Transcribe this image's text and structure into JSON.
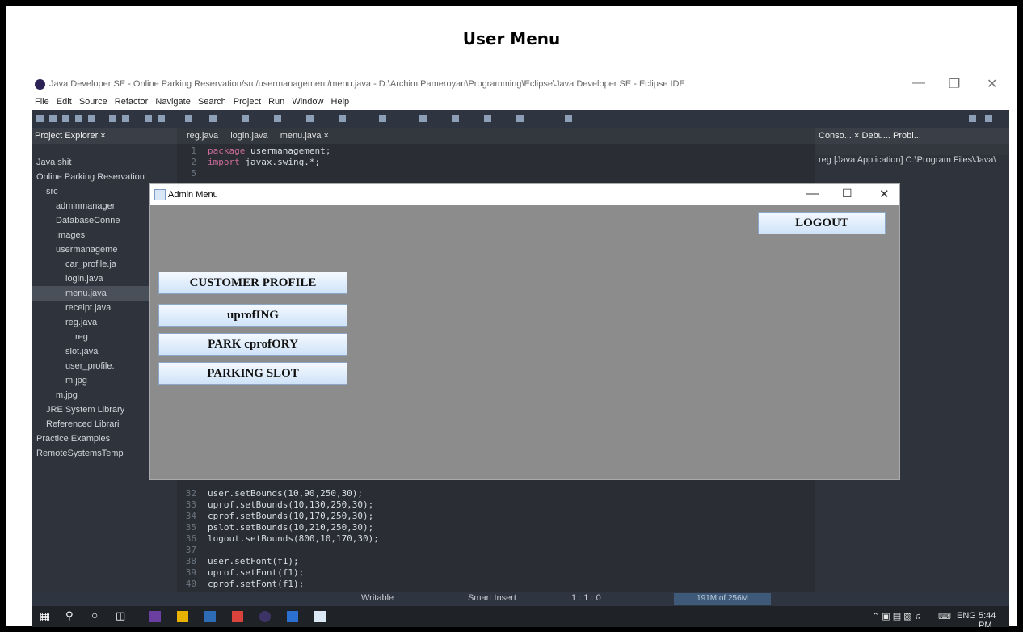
{
  "doc_title": "User Menu",
  "eclipse": {
    "window_title": "Java Developer SE - Online Parking Reservation/src/usermanagement/menu.java - D:\\Archim Pameroyan\\Programming\\Eclipse\\Java Developer SE - Eclipse IDE",
    "menu": [
      "File",
      "Edit",
      "Source",
      "Refactor",
      "Navigate",
      "Search",
      "Project",
      "Run",
      "Window",
      "Help"
    ],
    "explorer_title": "Project Explorer ×",
    "tree": [
      "Java shit",
      "Online Parking Reservation",
      "src",
      "adminmanager",
      "DatabaseConne",
      "Images",
      "usermanageme",
      "car_profile.ja",
      "login.java",
      "menu.java",
      "receipt.java",
      "reg.java",
      "reg",
      "slot.java",
      "user_profile.",
      "m.jpg",
      "m.jpg",
      "JRE System Library",
      "Referenced Librari",
      "Practice Examples",
      "RemoteSystemsTemp"
    ],
    "editor_tabs": [
      "reg.java",
      "login.java",
      "menu.java ×"
    ],
    "code_top": [
      {
        "n": "1",
        "a": "package",
        "b": " usermanagement;"
      },
      {
        "n": "2",
        "a": "import",
        "b": " javax.swing.*;"
      },
      {
        "n": "5",
        "a": "",
        "b": ""
      }
    ],
    "code_bottom": [
      {
        "n": "32",
        "t": "user.setBounds(10,90,250,30);"
      },
      {
        "n": "33",
        "t": "uprof.setBounds(10,130,250,30);"
      },
      {
        "n": "34",
        "t": "cprof.setBounds(10,170,250,30);"
      },
      {
        "n": "35",
        "t": "pslot.setBounds(10,210,250,30);"
      },
      {
        "n": "36",
        "t": "logout.setBounds(800,10,170,30);"
      },
      {
        "n": "37",
        "t": ""
      },
      {
        "n": "38",
        "t": "user.setFont(f1);"
      },
      {
        "n": "39",
        "t": "uprof.setFont(f1);"
      },
      {
        "n": "40",
        "t": "cprof.setFont(f1);"
      }
    ],
    "right_tabs": "Conso... ×   Debu...   Probl...",
    "console_line": "reg [Java Application] C:\\Program Files\\Java\\",
    "status": {
      "writable": "Writable",
      "insert": "Smart Insert",
      "pos": "1 : 1 : 0",
      "heap": "191M of 256M"
    }
  },
  "taskbar": {
    "lang": "ENG",
    "time": "5:44 PM"
  },
  "admin": {
    "title": "Admin Menu",
    "logout": "LOGOUT",
    "buttons": [
      "CUSTOMER PROFILE",
      "uprofING",
      "PARK cprofORY",
      "PARKING SLOT"
    ]
  }
}
